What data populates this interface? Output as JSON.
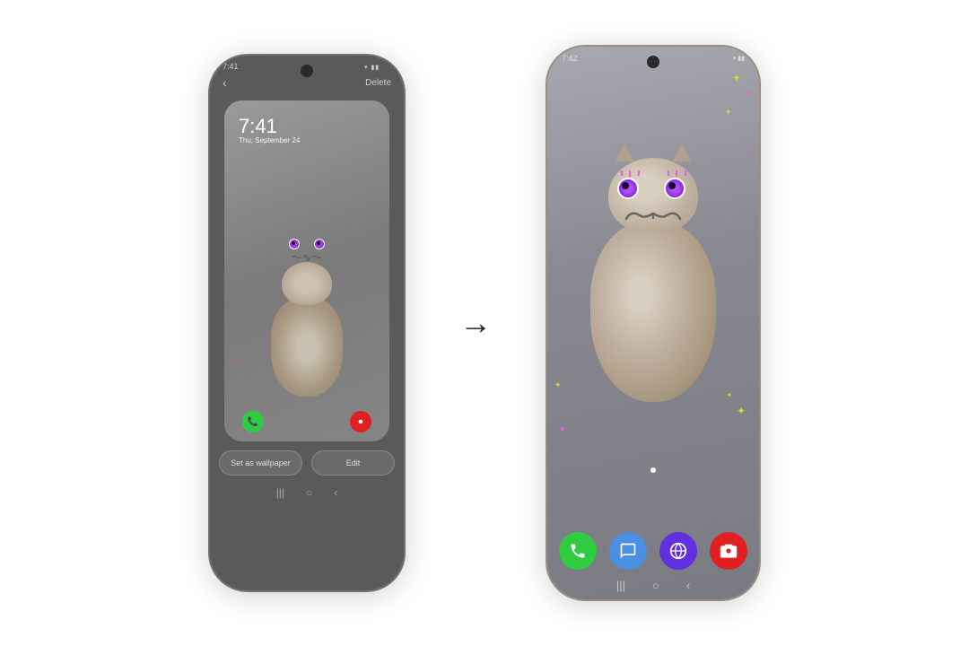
{
  "scene": {
    "bg": "#ffffff",
    "arrow": "→"
  },
  "left_phone": {
    "status_bar": {
      "time": "7:41",
      "icons": "▾▮▮"
    },
    "top_bar": {
      "back": "‹",
      "delete_label": "Delete"
    },
    "preview": {
      "lock_time": "7:41",
      "lock_date": "Thu, September 24"
    },
    "buttons": {
      "wallpaper_label": "Set as wallpaper",
      "edit_label": "Edit"
    },
    "nav": {
      "items": [
        "|||",
        "○",
        "‹"
      ]
    }
  },
  "right_phone": {
    "status_bar": {
      "time": "7:42",
      "icons": "▾▮▮"
    },
    "apps": [
      {
        "name": "phone",
        "color": "#2ecc40",
        "icon": "📞"
      },
      {
        "name": "messages",
        "color": "#4a90e2",
        "icon": "💬"
      },
      {
        "name": "browser",
        "color": "#6030e0",
        "icon": "🌐"
      },
      {
        "name": "camera",
        "color": "#e02020",
        "icon": "📷"
      }
    ],
    "nav": {
      "items": [
        "|||",
        "○",
        "‹"
      ]
    }
  },
  "decorations": {
    "hearts": [
      "♡",
      "♡"
    ],
    "sparkles": [
      "✦",
      "✦",
      "✦",
      "✦"
    ],
    "heart_color": "#e040c0",
    "sparkle_color_yellow": "#e0d030",
    "sparkle_color_pink": "#e040c0"
  }
}
